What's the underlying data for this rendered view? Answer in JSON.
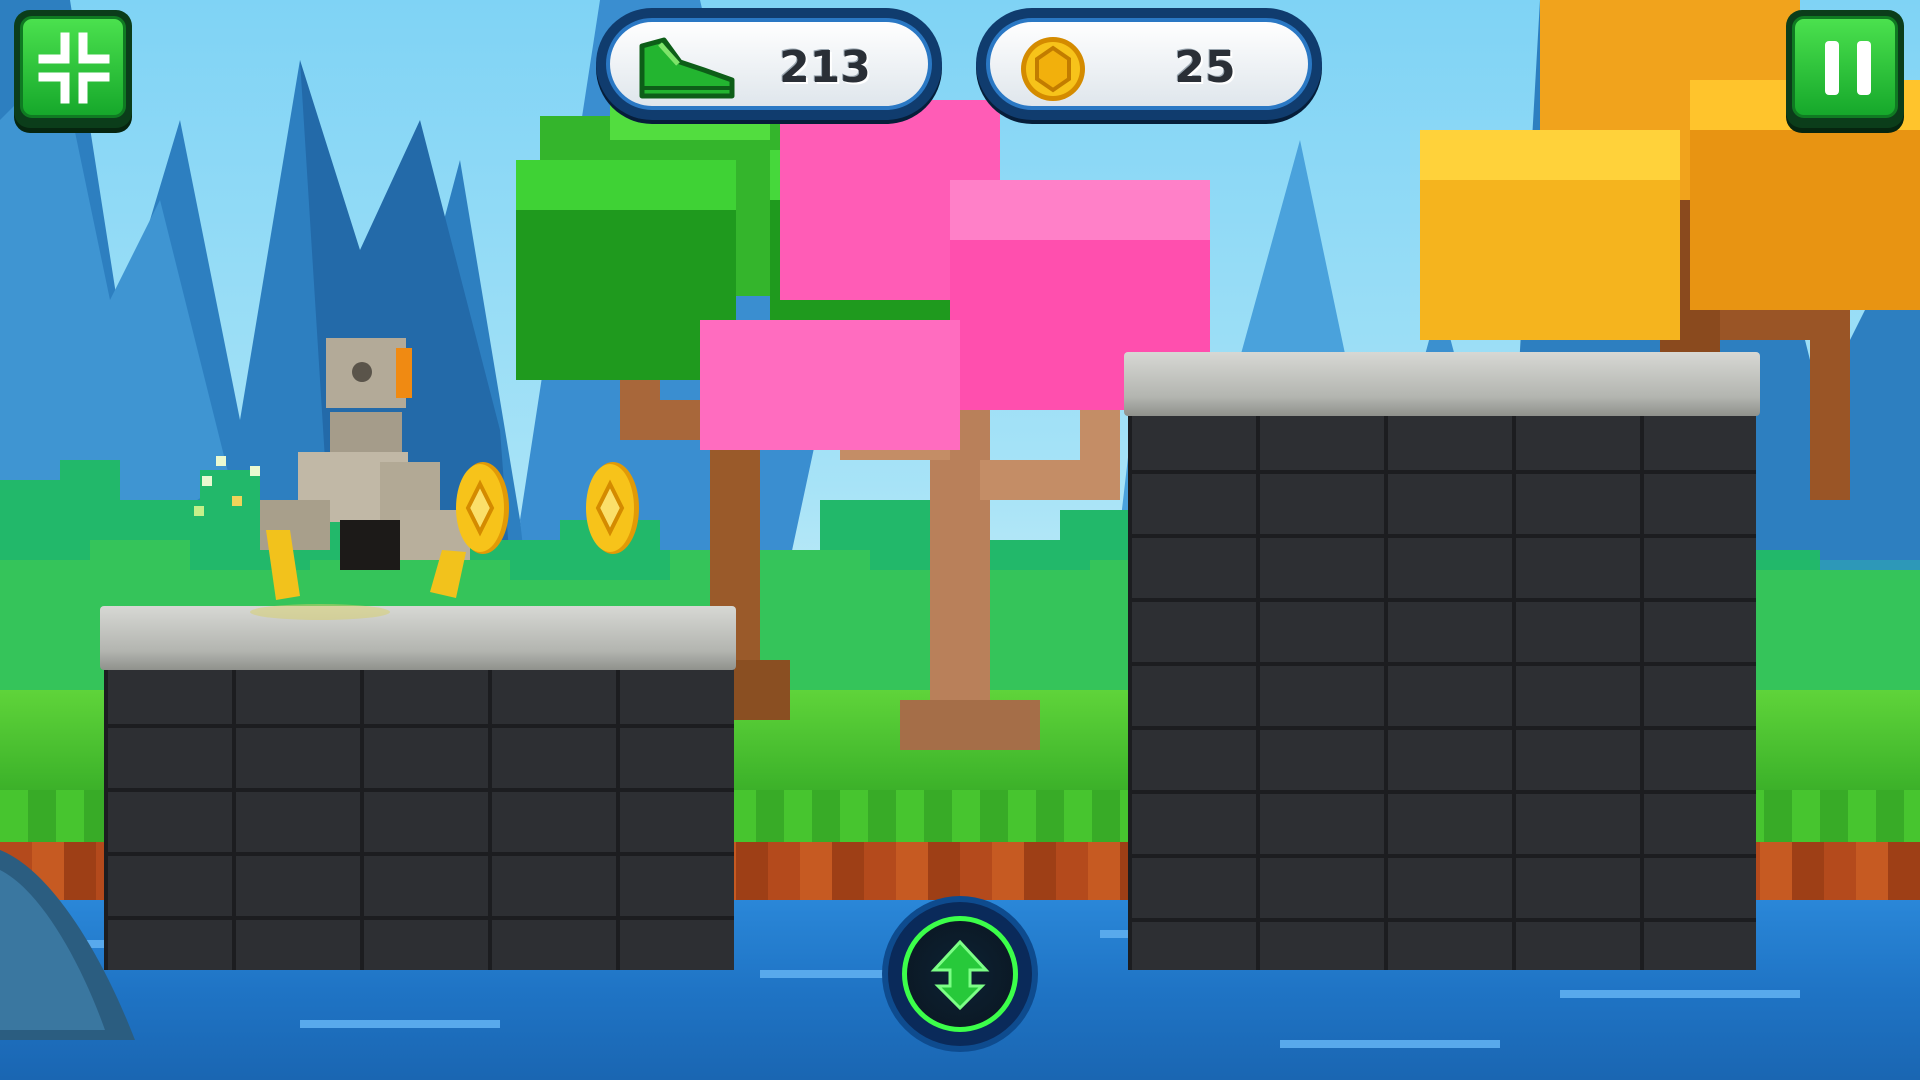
{
  "hud": {
    "distance": {
      "icon": "shoe-icon",
      "value": "213"
    },
    "coins": {
      "icon": "coin-icon",
      "value": "25"
    }
  },
  "buttons": {
    "shrink": {
      "icon": "collapse-arrows-icon"
    },
    "pause": {
      "icon": "pause-icon"
    },
    "jump": {
      "icon": "up-arrow-icon"
    }
  },
  "colors": {
    "button_green": "#2ec83a",
    "hud_border": "#103c6e",
    "coin_gold": "#f5b90c",
    "jump_ring": "#3cff4a"
  }
}
